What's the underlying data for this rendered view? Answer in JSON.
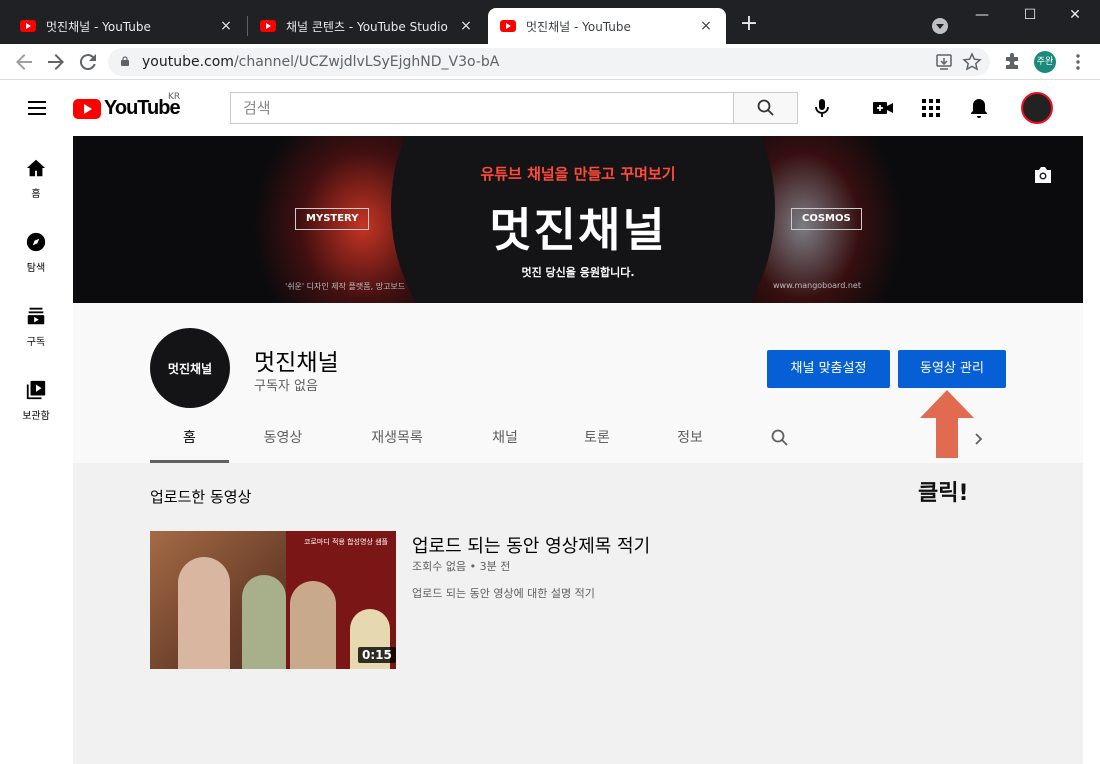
{
  "browser": {
    "tabs": [
      {
        "title": "멋진채널 - YouTube",
        "active": false
      },
      {
        "title": "채널 콘텐츠 - YouTube Studio",
        "active": false
      },
      {
        "title": "멋진채널 - YouTube",
        "active": true
      }
    ],
    "url_host": "youtube.com",
    "url_path": "/channel/UCZwjdlvLSyEjghND_V3o-bA",
    "profile_label": "주완",
    "new_tab": "+",
    "close": "×",
    "win_min": "—",
    "win_max": "☐",
    "win_close": "✕"
  },
  "youtube": {
    "logo_text": "YouTube",
    "region": "KR",
    "search_placeholder": "검색"
  },
  "sidebar": {
    "items": [
      {
        "label": "홈",
        "icon": "home-icon"
      },
      {
        "label": "탐색",
        "icon": "explore-icon"
      },
      {
        "label": "구독",
        "icon": "subscriptions-icon"
      },
      {
        "label": "보관함",
        "icon": "library-icon"
      }
    ]
  },
  "banner": {
    "subtitle": "유튜브 채널을 만들고 꾸며보기",
    "title": "멋진채널",
    "left_tag": "MYSTERY",
    "right_tag": "COSMOS",
    "slogan": "멋진 당신을 응원합니다.",
    "footer_left": "'쉬운' 디자인 제작 플랫폼, 망고보드",
    "footer_right": "www.mangoboard.net"
  },
  "channel": {
    "avatar_text": "멋진채널",
    "name": "멋진채널",
    "subscribers": "구독자 없음",
    "customize_button": "채널 맞춤설정",
    "manage_button": "동영상 관리",
    "tabs": [
      "홈",
      "동영상",
      "재생목록",
      "채널",
      "토론",
      "정보"
    ],
    "selected_tab": "홈"
  },
  "uploads": {
    "section_title": "업로드한 동영상",
    "video": {
      "title": "업로드 되는 동안 영상제목 적기",
      "meta": "조회수 없음 • 3분 전",
      "description": "업로드 되는 동안 영상에 대한 설명 적기",
      "duration": "0:15",
      "thumb_text": "코로마디 적용 합성영상 샘플"
    }
  },
  "annotation": {
    "label": "클릭!",
    "arrow_color": "#e06b50"
  },
  "colors": {
    "yt_red": "#ff0000",
    "button_blue": "#065fd4",
    "chrome_dark": "#202124"
  }
}
